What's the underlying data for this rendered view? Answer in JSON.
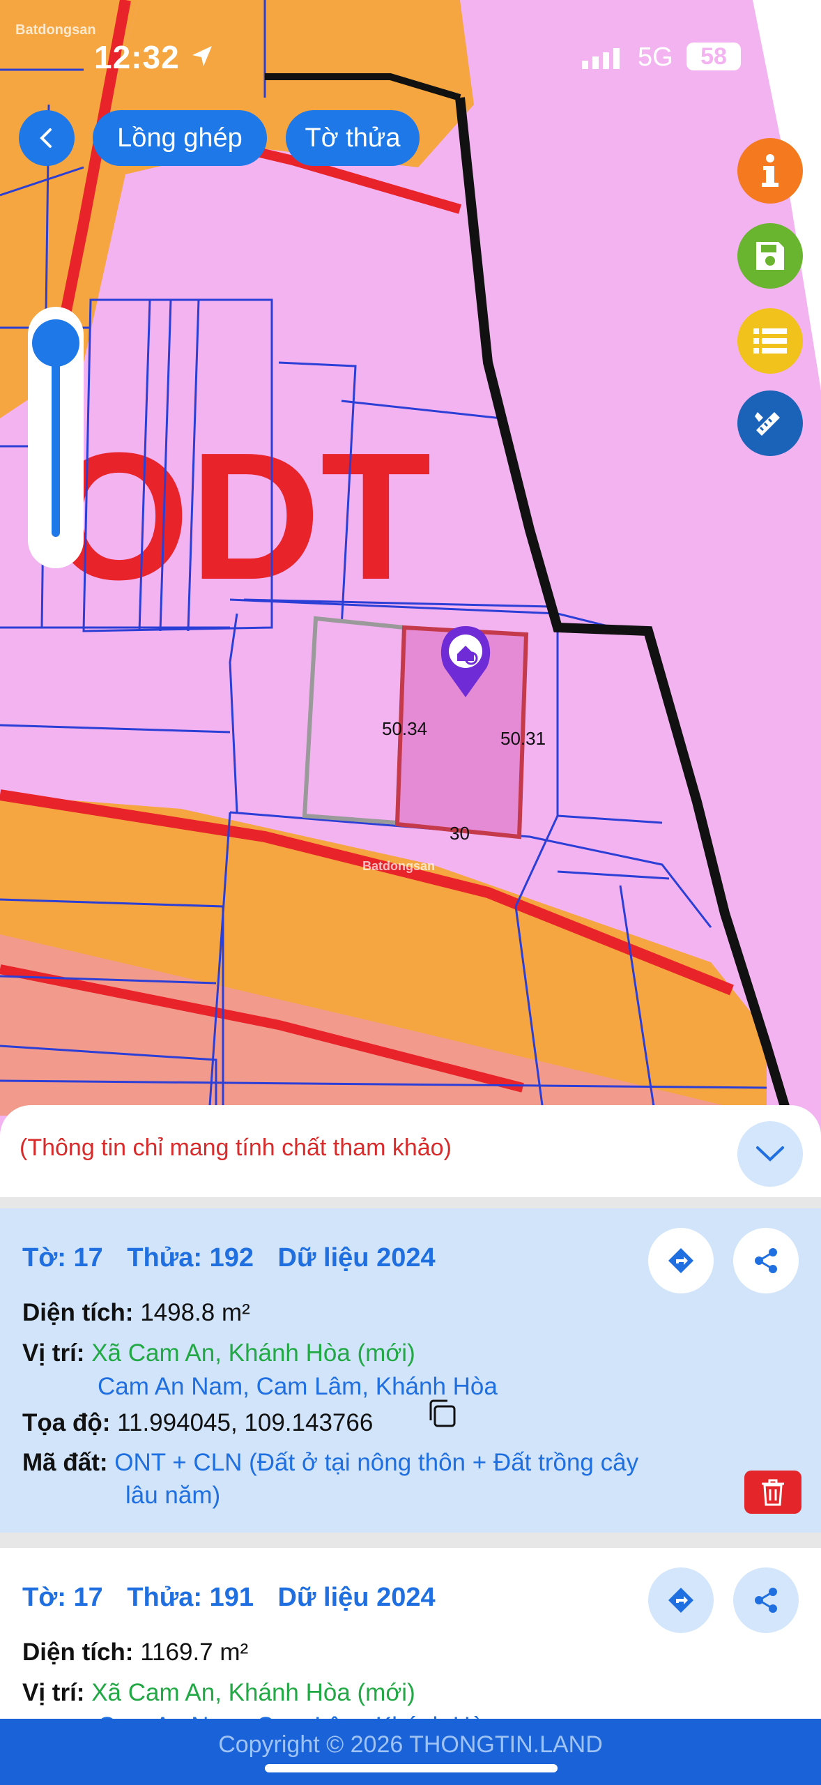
{
  "status_bar": {
    "time": "12:32",
    "network": "5G",
    "battery": "58"
  },
  "watermark": "Batdongsan",
  "toolbar": {
    "back_icon": "chevron-left-icon",
    "layer_button": "Lồng ghép",
    "parcel_button": "Tờ thửa"
  },
  "side_actions": [
    "info-icon",
    "save-icon",
    "list-icon",
    "ruler-icon"
  ],
  "zoom": {
    "level": 1.0
  },
  "map": {
    "zone_label": "ODT",
    "dimensions": [
      "50.34",
      "50.31",
      "30"
    ],
    "colors": {
      "residential": "#f3b3f0",
      "agri": "#f5a640",
      "boundary": "#2b3fd6",
      "road": "#e8232a"
    }
  },
  "sheet": {
    "note": "(Thông tin chỉ mang tính chất tham khảo)",
    "cards": [
      {
        "to": "Tờ: 17",
        "thua": "Thửa: 192",
        "data": "Dữ liệu 2024",
        "area_label": "Diện tích:",
        "area_value": "1498.8 m²",
        "loc_label": "Vị trí:",
        "loc_new": "Xã Cam An, Khánh Hòa (mới)",
        "loc_old": "Cam An Nam, Cam Lâm, Khánh Hòa",
        "coord_label": "Tọa độ:",
        "coord_value": "11.994045, 109.143766",
        "code_label": "Mã đất:",
        "code_line1": "ONT + CLN (Đất ở tại nông thôn + Đất trồng cây",
        "code_line2": "lâu năm)"
      },
      {
        "to": "Tờ: 17",
        "thua": "Thửa: 191",
        "data": "Dữ liệu 2024",
        "area_label": "Diện tích:",
        "area_value": "1169.7 m²",
        "loc_label": "Vị trí:",
        "loc_new": "Xã Cam An, Khánh Hòa (mới)",
        "loc_old": "Cam An Nam, Cam Lâm, Khánh Hòa"
      }
    ]
  },
  "footer": {
    "copyright": "Copyright © 2026 THONGTIN.LAND"
  }
}
